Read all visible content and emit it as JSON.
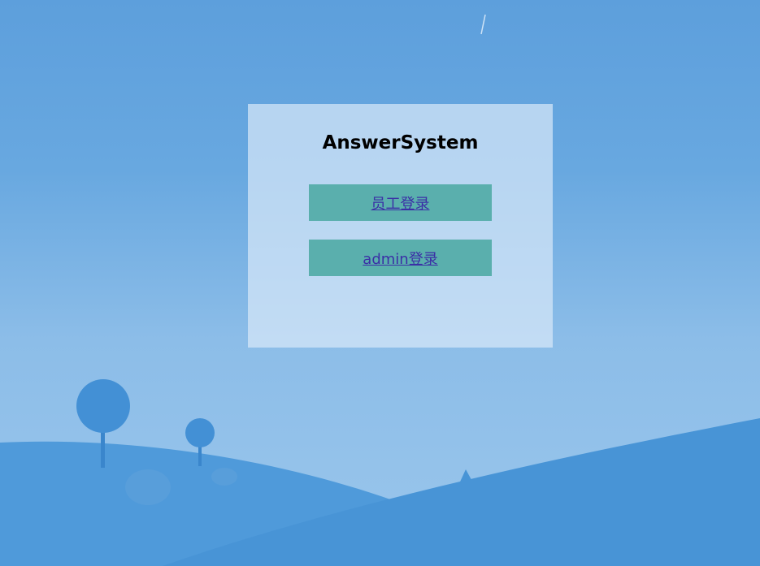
{
  "page": {
    "title": "AnswerSystem"
  },
  "login": {
    "employee_label": "员工登录",
    "admin_label": "admin登录"
  },
  "colors": {
    "button_bg": "#5aafad",
    "link_text": "#3b2fa6",
    "sky": "#5d9fdc",
    "hill": "#4a98d9"
  },
  "icons": {
    "background": "landscape-illustration"
  }
}
